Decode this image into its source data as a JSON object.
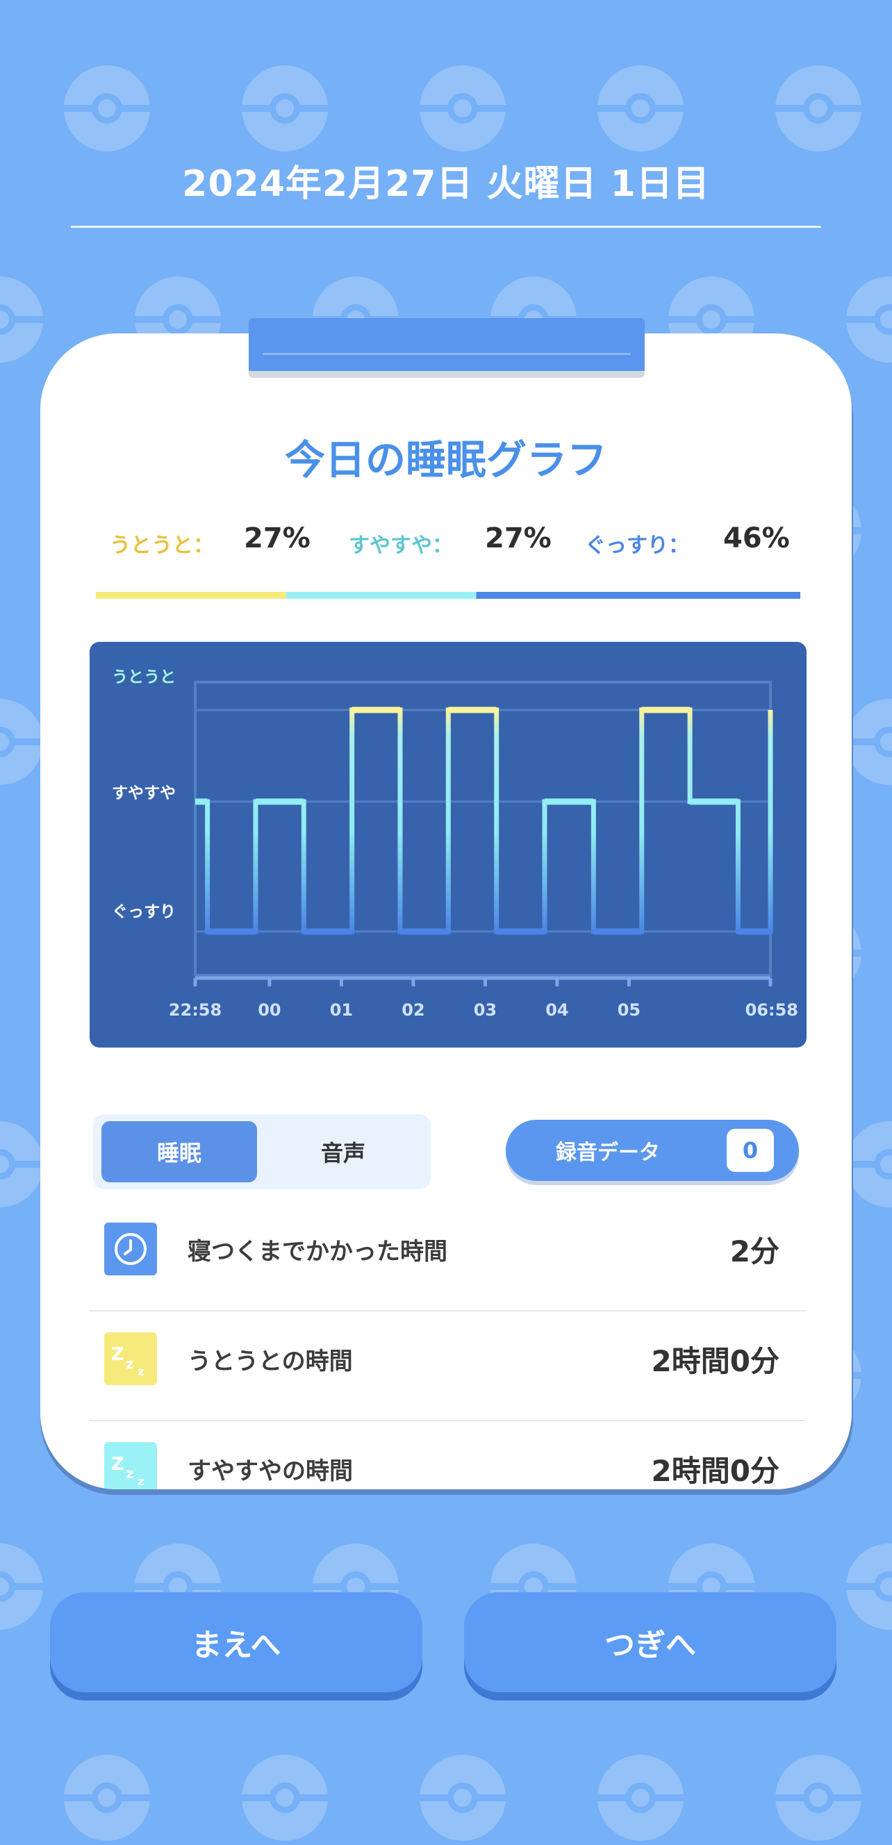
{
  "header": {
    "date": "2024年2月27日 火曜日 1日目"
  },
  "card": {
    "title": "今日の睡眠グラフ",
    "stats": [
      {
        "label": "うとうと：",
        "value": "27%",
        "color": "#e8c240"
      },
      {
        "label": "すやすや：",
        "value": "27%",
        "color": "#5ec6cf"
      },
      {
        "label": "ぐっすり：",
        "value": "46%",
        "color": "#4a86e6"
      }
    ],
    "ratio_colors": {
      "light": "#f7ea7c",
      "medium": "#9af1f5",
      "deep": "#4a86e6"
    }
  },
  "chart_data": {
    "type": "line",
    "step": true,
    "y_levels": [
      "うとうと",
      "すやすや",
      "ぐっすり"
    ],
    "x_ticks": [
      "22:58",
      "00",
      "01",
      "02",
      "03",
      "04",
      "05",
      "06:58"
    ],
    "x_range": [
      "22:58",
      "06:58"
    ],
    "series": [
      {
        "x_hours": [
          0,
          0.17,
          0.84,
          1.51,
          2.18,
          2.85,
          3.52,
          4.19,
          4.86,
          5.54,
          6.21,
          6.88,
          7.55,
          8.0
        ],
        "y": [
          "すやすや",
          "ぐっすり",
          "すやすや",
          "ぐっすり",
          "うとうと",
          "ぐっすり",
          "うとうと",
          "ぐっすり",
          "すやすや",
          "ぐっすり",
          "うとうと",
          "すやすや",
          "ぐっすり",
          "うとうと"
        ]
      }
    ]
  },
  "tabs": {
    "sleep": "睡眠",
    "sound": "音声"
  },
  "recording": {
    "label": "録音データ",
    "count": "0"
  },
  "details": [
    {
      "icon": "clock-icon",
      "label": "寝つくまでかかった時間",
      "value": "2分",
      "icon_color": "#5b97ee"
    },
    {
      "icon": "zzz-icon",
      "label": "うとうとの時間",
      "value": "2時間0分",
      "icon_color": "#f7ea7c"
    },
    {
      "icon": "zzz-icon",
      "label": "すやすやの時間",
      "value": "2時間0分",
      "icon_color": "#9af1f5"
    }
  ],
  "nav": {
    "prev": "まえへ",
    "next": "つぎへ"
  }
}
